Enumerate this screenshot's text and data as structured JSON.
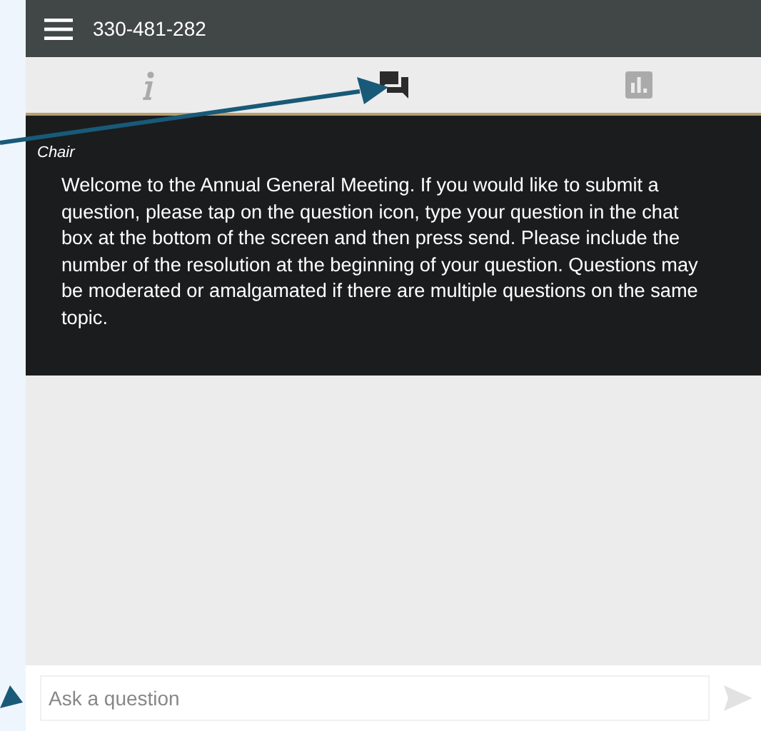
{
  "header": {
    "title": "330-481-282"
  },
  "tabs": [
    {
      "kind": "info",
      "selected": false
    },
    {
      "kind": "chat",
      "selected": true
    },
    {
      "kind": "poll",
      "selected": false
    }
  ],
  "messages": [
    {
      "author": "Chair",
      "text": "Welcome to the Annual General Meeting. If you would like to submit a question, please tap on the question icon, type your question in the chat box at the bottom of the screen and then press send. Please include the number of the resolution at the beginning of your question. Questions may be moderated or amalgamated if there are multiple questions on the same topic."
    }
  ],
  "composer": {
    "placeholder": "Ask a question"
  }
}
